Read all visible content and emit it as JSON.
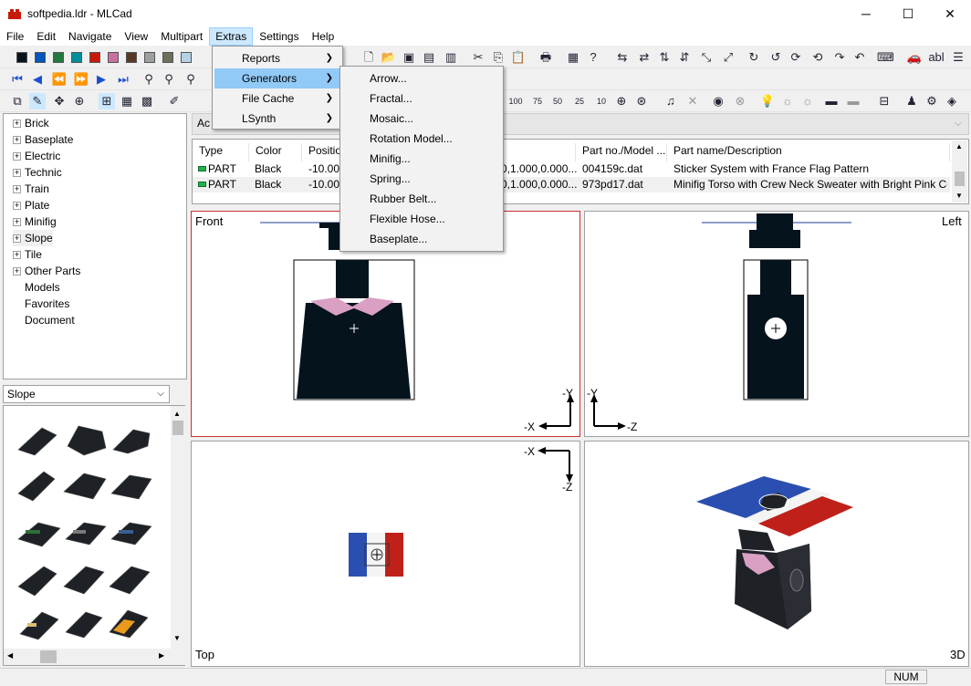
{
  "window": {
    "title": "softpedia.ldr - MLCad",
    "min_glyph": "─",
    "max_glyph": "☐",
    "close_glyph": "✕"
  },
  "menubar": [
    "File",
    "Edit",
    "Navigate",
    "View",
    "Multipart",
    "Extras",
    "Settings",
    "Help"
  ],
  "extras_menu": [
    {
      "label": "Reports",
      "submenu": true
    },
    {
      "label": "Generators",
      "submenu": true
    },
    {
      "label": "File Cache",
      "submenu": true
    },
    {
      "label": "LSynth",
      "submenu": true
    }
  ],
  "generators_menu": [
    "Arrow...",
    "Fractal...",
    "Mosaic...",
    "Rotation Model...",
    "Minifig...",
    "Spring...",
    "Rubber Belt...",
    "Flexible Hose...",
    "Baseplate..."
  ],
  "tree": [
    {
      "label": "Brick",
      "expandable": true
    },
    {
      "label": "Baseplate",
      "expandable": true
    },
    {
      "label": "Electric",
      "expandable": true
    },
    {
      "label": "Technic",
      "expandable": true
    },
    {
      "label": "Train",
      "expandable": true
    },
    {
      "label": "Plate",
      "expandable": true
    },
    {
      "label": "Minifig",
      "expandable": true
    },
    {
      "label": "Slope",
      "expandable": true
    },
    {
      "label": "Tile",
      "expandable": true
    },
    {
      "label": "Other Parts",
      "expandable": true
    },
    {
      "label": "Models",
      "expandable": false
    },
    {
      "label": "Favorites",
      "expandable": false
    },
    {
      "label": "Document",
      "expandable": false
    }
  ],
  "category_combo": {
    "value": "Slope"
  },
  "addbar_label": "Ac",
  "grid": {
    "headers": [
      "Type",
      "Color",
      "Position",
      "Part no./Model ...",
      "Part name/Description"
    ],
    "rows": [
      {
        "type": "PART",
        "color": "Black",
        "position": "-10.000",
        "matrix": "0,1.000,0.000...",
        "part": "004159c.dat",
        "desc": "Sticker System with France Flag Pattern"
      },
      {
        "type": "PART",
        "color": "Black",
        "position": "-10.000",
        "matrix": "0,1.000,0.000...",
        "part": "973pd17.dat",
        "desc": "Minifig Torso with Crew Neck Sweater with Bright Pink Coll..."
      }
    ]
  },
  "views": {
    "front": "Front",
    "left": "Left",
    "top": "Top",
    "3d": "3D"
  },
  "axes": {
    "front_y": "-Y",
    "front_x": "-X",
    "left_y": "-Y",
    "left_z": "-Z",
    "top_x": "-X",
    "top_z": "-Z"
  },
  "zoom_labels": [
    "100",
    "75",
    "50",
    "25",
    "10"
  ],
  "toolbar_text": {
    "abl": "abl"
  },
  "status": {
    "num": "NUM"
  },
  "colors": {
    "swatches": [
      "#05131d",
      "#0055bf",
      "#237841",
      "#008f9b",
      "#c91a09",
      "#c870a0",
      "#583927",
      "#9ba19d",
      "#6d6e5c",
      "#b4d2e3"
    ],
    "accent": "#cce8ff"
  }
}
